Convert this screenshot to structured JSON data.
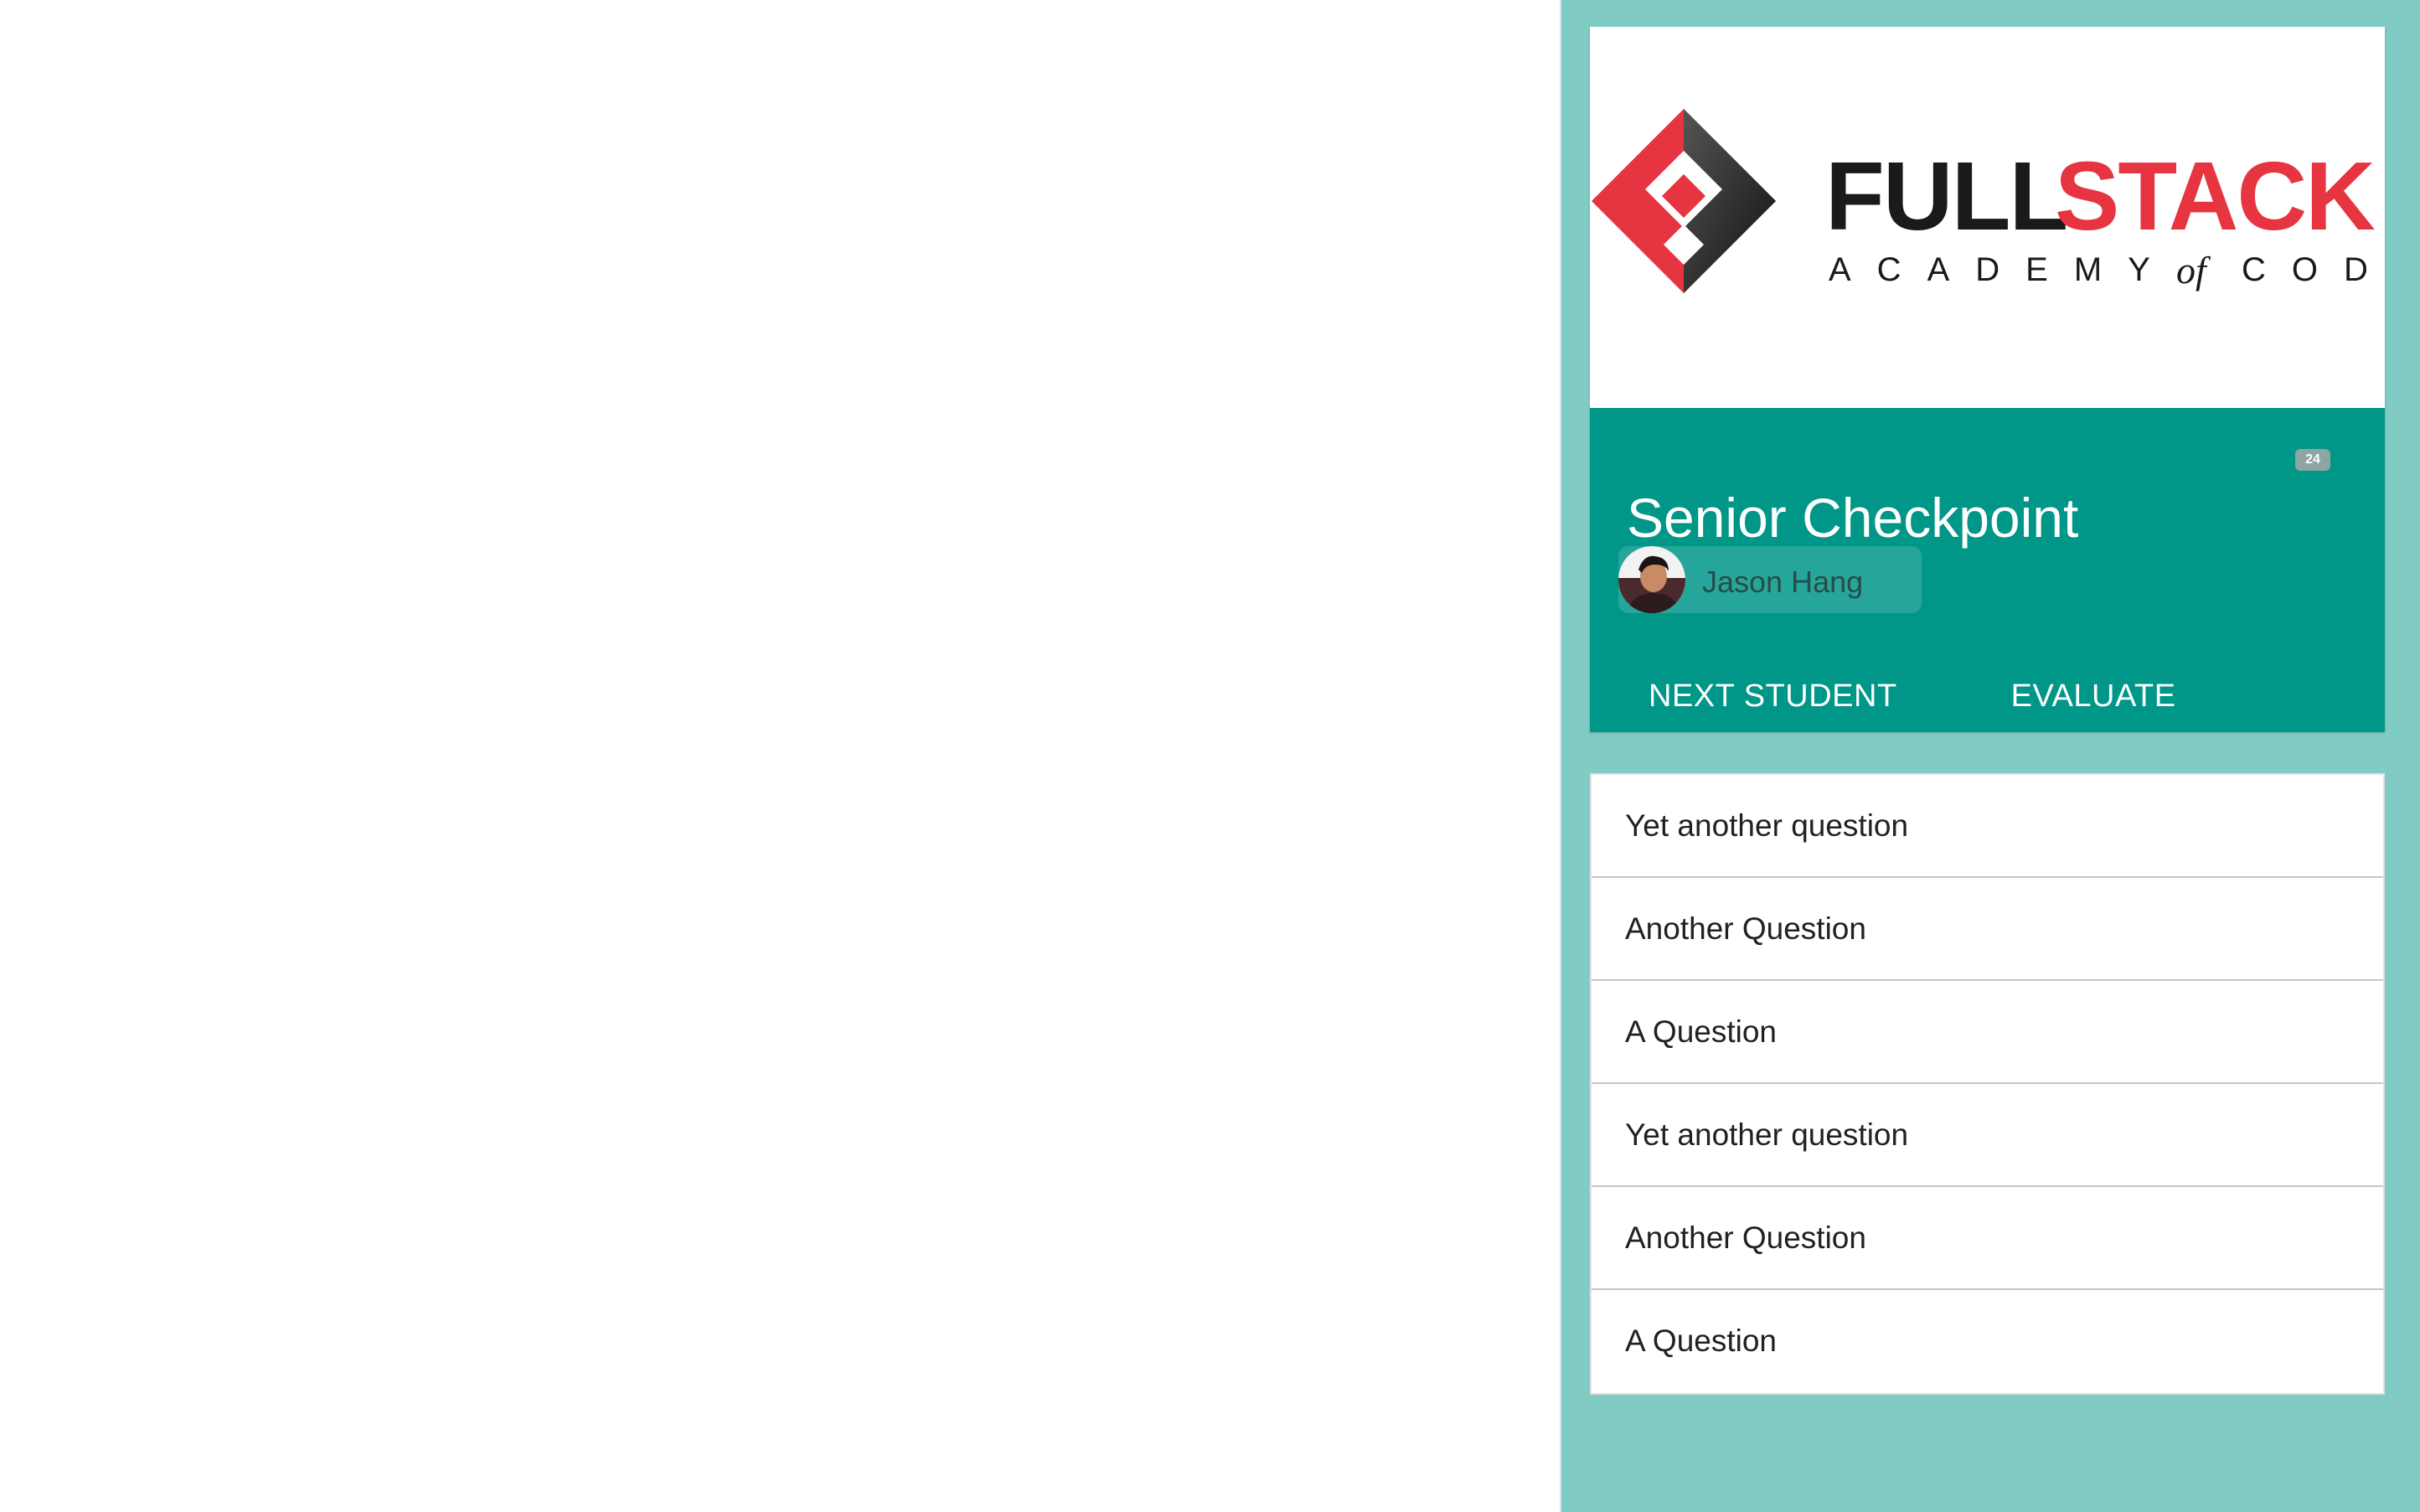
{
  "card": {
    "logo": {
      "wordmark_primary": "FULL",
      "wordmark_accent": "STACK",
      "tagline_1": "ACADEMY",
      "tagline_of": "of",
      "tagline_2": "CODE"
    },
    "title": "Senior Checkpoint",
    "count_badge": "24",
    "user": {
      "name": "Jason Hang"
    },
    "actions": {
      "next_label": "NEXT STUDENT",
      "evaluate_label": "EVALUATE"
    }
  },
  "questions": [
    {
      "label": "Yet another question"
    },
    {
      "label": "Another Question"
    },
    {
      "label": "A Question"
    },
    {
      "label": "Yet another question"
    },
    {
      "label": "Another Question"
    },
    {
      "label": "A Question"
    }
  ],
  "colors": {
    "panel_bg": "#80cbc4",
    "header_bg": "#009688",
    "brand_red": "#e63541",
    "brand_black": "#1a1a1a"
  }
}
